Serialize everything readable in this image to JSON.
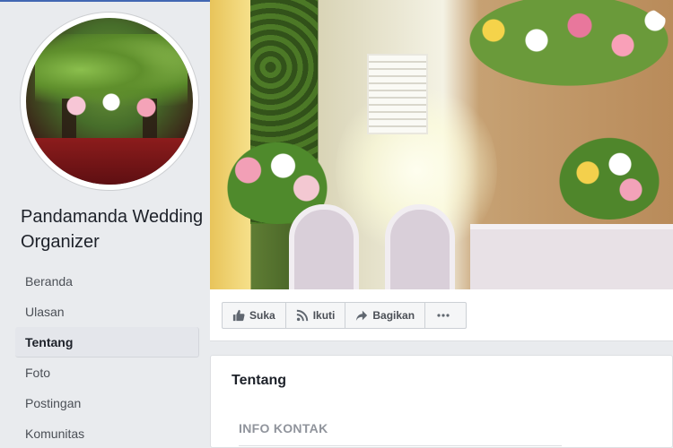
{
  "page": {
    "name": "Pandamanda Wedding Organizer"
  },
  "nav": {
    "items": [
      {
        "label": "Beranda",
        "active": false
      },
      {
        "label": "Ulasan",
        "active": false
      },
      {
        "label": "Tentang",
        "active": true
      },
      {
        "label": "Foto",
        "active": false
      },
      {
        "label": "Postingan",
        "active": false
      },
      {
        "label": "Komunitas",
        "active": false
      }
    ]
  },
  "actions": {
    "like_label": "Suka",
    "like_icon": "thumbs-up-icon",
    "follow_label": "Ikuti",
    "follow_icon": "rss-icon",
    "share_label": "Bagikan",
    "share_icon": "share-arrow-icon",
    "more_icon": "more-dots-icon"
  },
  "about": {
    "title": "Tentang",
    "contact_section": "INFO KONTAK"
  },
  "colors": {
    "brand_blue": "#4267b2",
    "text_primary": "#1d2129",
    "text_secondary": "#4b4f56",
    "muted": "#90949c",
    "background": "#e9ebee"
  }
}
